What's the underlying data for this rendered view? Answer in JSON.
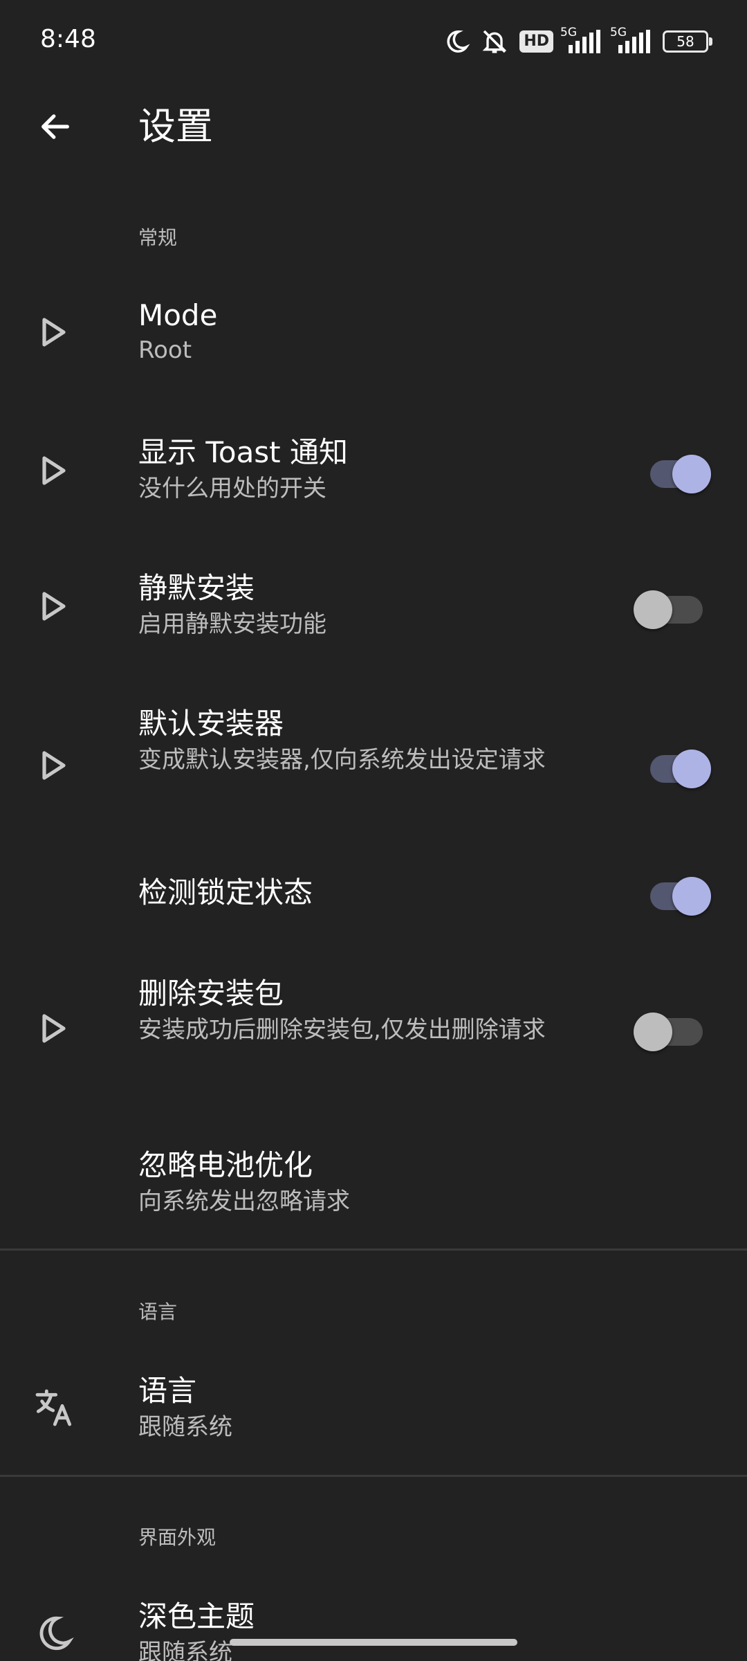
{
  "status_bar": {
    "time": "8:48",
    "hd_label": "HD",
    "net1": "5G",
    "net2": "5G",
    "battery": "58",
    "icons": [
      "moon-icon",
      "mute-icon",
      "signal-icon",
      "battery-icon"
    ]
  },
  "app_bar": {
    "title": "设置",
    "back_icon": "arrow-left-icon"
  },
  "sections": {
    "general": "常规",
    "language": "语言",
    "appearance": "界面外观"
  },
  "settings": {
    "mode": {
      "title": "Mode",
      "subtitle": "Root",
      "icon": "play-outline-icon"
    },
    "toast": {
      "title": "显示 Toast 通知",
      "subtitle": "没什么用处的开关",
      "icon": "play-outline-icon",
      "enabled": true
    },
    "silent_install": {
      "title": "静默安装",
      "subtitle": "启用静默安装功能",
      "icon": "play-outline-icon",
      "enabled": false
    },
    "default_installer": {
      "title": "默认安装器",
      "subtitle": "变成默认安装器,仅向系统发出设定请求",
      "icon": "play-outline-icon",
      "enabled": true
    },
    "lock_detect": {
      "title": "检测锁定状态",
      "enabled": true
    },
    "delete_package": {
      "title": "删除安装包",
      "subtitle": "安装成功后删除安装包,仅发出删除请求",
      "icon": "play-outline-icon",
      "enabled": false
    },
    "battery_opt": {
      "title": "忽略电池优化",
      "subtitle": "向系统发出忽略请求"
    },
    "language": {
      "title": "语言",
      "subtitle": "跟随系统",
      "icon": "translate-icon"
    },
    "dark_theme": {
      "title": "深色主题",
      "subtitle": "跟随系统",
      "icon": "moon-icon"
    }
  },
  "colors": {
    "background": "#222222",
    "accent_thumb": "#aeb3e6",
    "accent_track": "#545770",
    "secondary_text": "#bdbdbd"
  }
}
